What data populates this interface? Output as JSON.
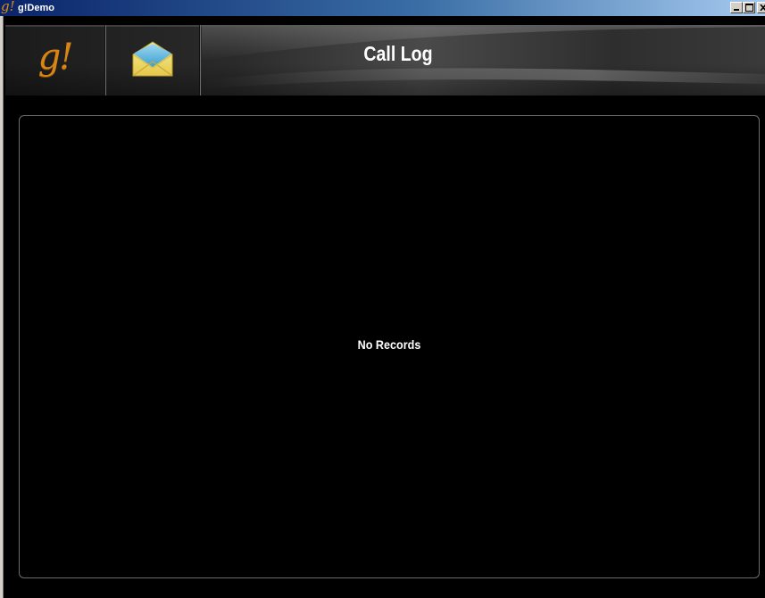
{
  "window": {
    "title": "g!Demo",
    "app_icon": "g!",
    "controls": [
      "minimize-icon",
      "maximize-icon",
      "close-icon"
    ]
  },
  "header": {
    "brand_logo": "g!",
    "mail_icon": "envelope-icon",
    "title": "Call Log"
  },
  "main": {
    "empty_message": "No Records"
  },
  "colors": {
    "titlebar_start": "#0a246a",
    "titlebar_end": "#a6caf0",
    "brand_orange": "#d88516",
    "background": "#000000",
    "text": "#ffffff"
  }
}
